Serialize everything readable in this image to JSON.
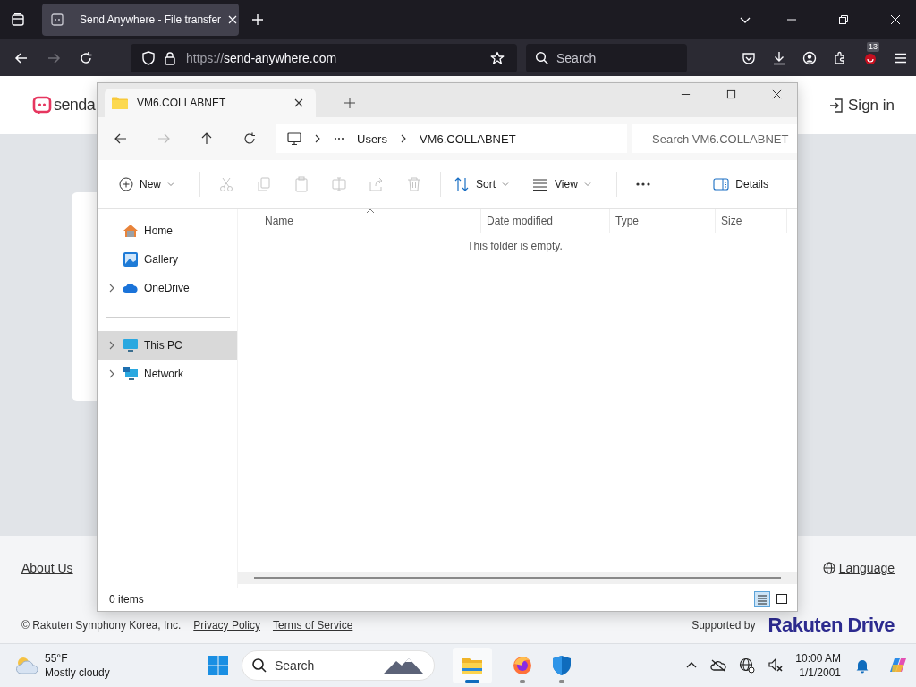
{
  "browser": {
    "tab": {
      "title": "Send Anywhere - File transfer",
      "selected": true
    },
    "url": {
      "scheme": "https://",
      "host": "send-anywhere.com"
    },
    "search": {
      "placeholder": "Search"
    },
    "extension_badge": "13"
  },
  "page": {
    "logo_text": "senda",
    "sign_in": "Sign in",
    "footer": {
      "about": "About Us",
      "language": "Language",
      "copyright": "© Rakuten Symphony Korea, Inc.",
      "privacy": "Privacy Policy",
      "terms": "Terms of Service",
      "supported_by": "Supported by",
      "partner": "Rakuten Drive"
    }
  },
  "explorer": {
    "tab": {
      "title": "VM6.COLLABNET",
      "selected": true
    },
    "breadcrumb": [
      "Users",
      "VM6.COLLABNET"
    ],
    "search": {
      "placeholder": "Search VM6.COLLABNET"
    },
    "new_label": "New",
    "edit_actions": [
      {
        "kind": "cut",
        "disabled": true
      },
      {
        "kind": "copy",
        "disabled": true
      },
      {
        "kind": "paste",
        "disabled": true
      },
      {
        "kind": "rename",
        "disabled": true
      },
      {
        "kind": "share",
        "disabled": true
      },
      {
        "kind": "delete",
        "disabled": true
      }
    ],
    "sort_label": "Sort",
    "view_label": "View",
    "details_label": "Details",
    "nav_groups": [
      [
        {
          "label": "Home",
          "kind": "home",
          "expandable": false,
          "selected": false
        },
        {
          "label": "Gallery",
          "kind": "gallery",
          "expandable": false,
          "selected": false
        },
        {
          "label": "OneDrive",
          "kind": "cloud",
          "expandable": true,
          "selected": false
        }
      ],
      [
        {
          "label": "This PC",
          "kind": "pc",
          "expandable": true,
          "selected": true
        },
        {
          "label": "Network",
          "kind": "network",
          "expandable": true,
          "selected": false
        }
      ]
    ],
    "columns": [
      "Name",
      "Date modified",
      "Type",
      "Size"
    ],
    "empty_message": "This folder is empty.",
    "status": "0 items",
    "layouts": [
      {
        "kind": "details",
        "selected": true
      },
      {
        "kind": "tiles",
        "selected": false
      }
    ]
  },
  "taskbar": {
    "weather": {
      "temperature": "55°F",
      "condition": "Mostly cloudy"
    },
    "search": {
      "placeholder": "Search"
    },
    "apps": [
      {
        "kind": "explorer",
        "active": true
      },
      {
        "kind": "firefox",
        "active": false
      },
      {
        "kind": "defender",
        "active": false
      }
    ],
    "time": "10:00 AM",
    "date": "1/1/2001"
  }
}
